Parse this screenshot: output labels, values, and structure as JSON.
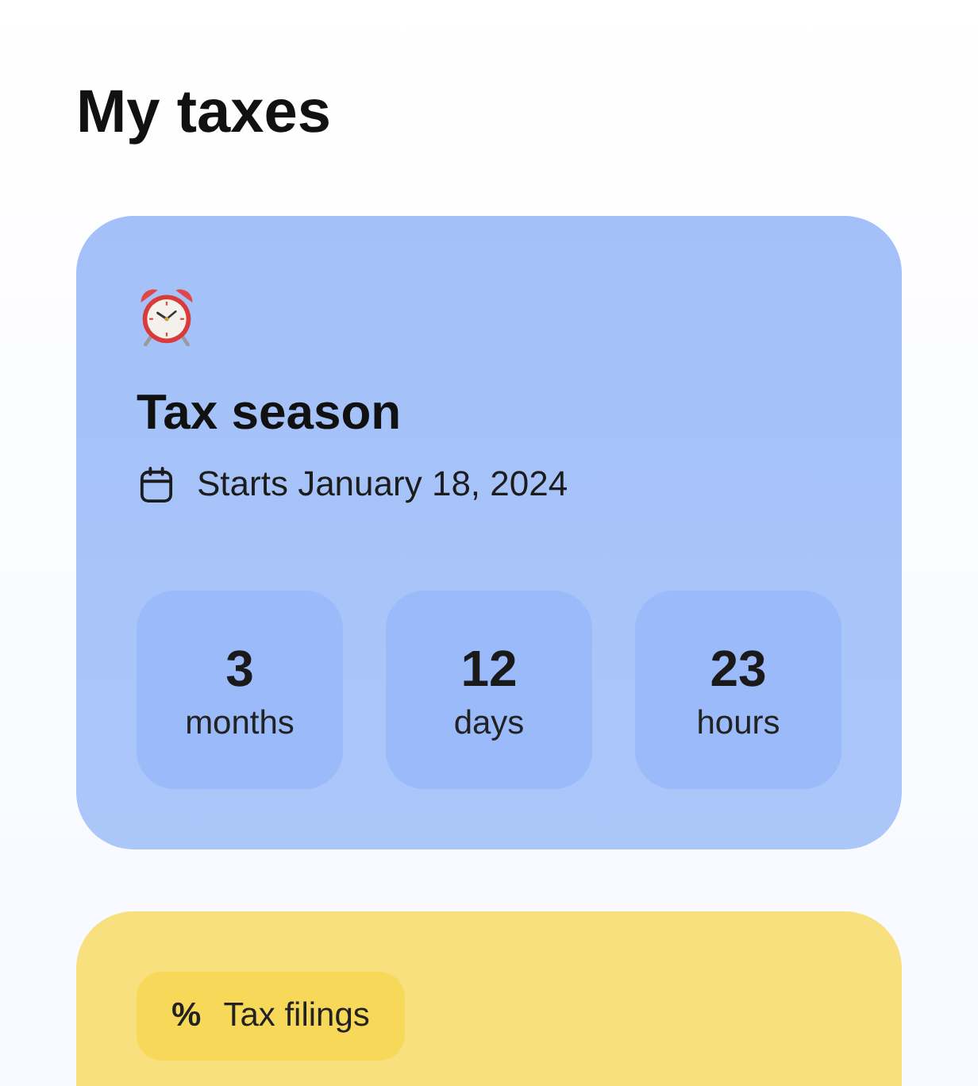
{
  "page": {
    "title": "My taxes"
  },
  "season_card": {
    "title": "Tax season",
    "start_date": "Starts January 18, 2024",
    "countdown": [
      {
        "value": "3",
        "unit": "months"
      },
      {
        "value": "12",
        "unit": "days"
      },
      {
        "value": "23",
        "unit": "hours"
      }
    ]
  },
  "filings_card": {
    "chip": {
      "symbol": "%",
      "label": "Tax filings"
    }
  }
}
